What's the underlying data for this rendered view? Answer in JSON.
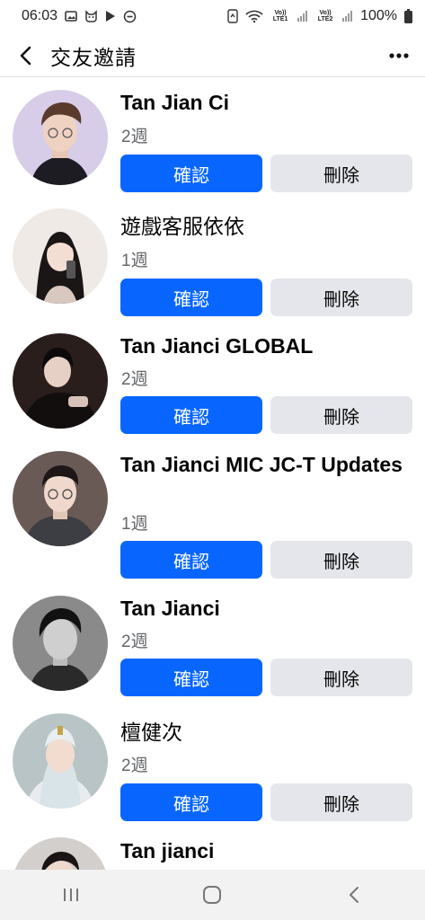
{
  "status_bar": {
    "time": "06:03",
    "net1": "Vo)) LTE1",
    "net2": "Vo)) LTE2",
    "battery": "100%"
  },
  "header": {
    "title": "交友邀請"
  },
  "buttons": {
    "confirm": "確認",
    "delete": "刪除"
  },
  "requests": [
    {
      "name": "Tan Jian Ci",
      "age": "2週"
    },
    {
      "name": "遊戲客服依依",
      "age": "1週"
    },
    {
      "name": "Tan Jianci  GLOBAL",
      "age": "2週"
    },
    {
      "name": "Tan Jianci MIC JC-T Updates",
      "age": "1週"
    },
    {
      "name": "Tan Jianci",
      "age": "2週"
    },
    {
      "name": "檀健次",
      "age": "2週"
    },
    {
      "name": "Tan jianci",
      "age": ""
    }
  ],
  "colors": {
    "confirm_bg": "#0866ff",
    "delete_bg": "#e4e6eb",
    "secondary_text": "#65676b"
  }
}
